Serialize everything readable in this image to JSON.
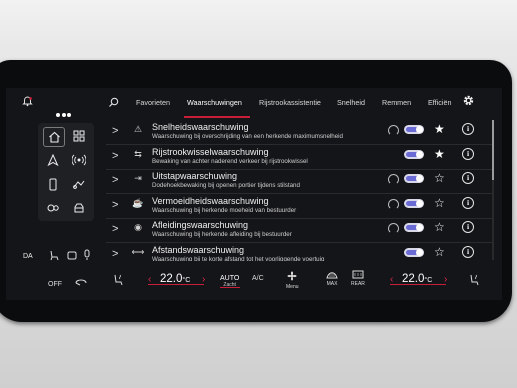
{
  "tabs": [
    {
      "label": "Favorieten"
    },
    {
      "label": "Waarschuwingen"
    },
    {
      "label": "Rijstrookassistentie"
    },
    {
      "label": "Snelheid"
    },
    {
      "label": "Remmen"
    },
    {
      "label": "Efficiën"
    }
  ],
  "active_tab": "Waarschuwingen",
  "rows": [
    {
      "title": "Snelheidswaarschuwing",
      "subtitle": "Waarschuwing bij overschrijding van een herkende maximumsnelheid",
      "icon": "speed-warning-icon",
      "auto": true,
      "toggle_on": true,
      "favorite": true
    },
    {
      "title": "Rijstrookwisselwaarschuwing",
      "subtitle": "Bewaking van achter naderend verkeer bij rijstrookwissel",
      "icon": "lane-change-icon",
      "auto": false,
      "toggle_on": true,
      "favorite": true
    },
    {
      "title": "Uitstapwaarschuwing",
      "subtitle": "Dodehoekbewaking bij openen portier tijdens stilstand",
      "icon": "exit-warning-icon",
      "auto": true,
      "toggle_on": true,
      "favorite": false
    },
    {
      "title": "Vermoeidheidswaarschuwing",
      "subtitle": "Waarschuwing bij herkende moeheid van bestuurder",
      "icon": "fatigue-icon",
      "auto": true,
      "toggle_on": true,
      "favorite": false
    },
    {
      "title": "Afleidingswaarschuwing",
      "subtitle": "Waarschuwing bij herkende afleiding bij bestuurder",
      "icon": "distraction-icon",
      "auto": true,
      "toggle_on": true,
      "favorite": false
    },
    {
      "title": "Afstandswaarschuwing",
      "subtitle": "Waarschuwing bij te korte afstand tot het voorliggende voertuig",
      "icon": "distance-icon",
      "auto": false,
      "toggle_on": true,
      "favorite": false
    }
  ],
  "left_status": {
    "lang": "DA"
  },
  "climate": {
    "off_label": "OFF",
    "temp_left": "22.0",
    "temp_right": "22.0",
    "temp_unit": "°C",
    "auto_label": "AUTO",
    "auto_sub": "Zacht",
    "ac_label": "A/C",
    "menu_label": "Menu",
    "max_label": "MAX",
    "rear_label": "REAR"
  },
  "accent_color": "#c81e3a"
}
